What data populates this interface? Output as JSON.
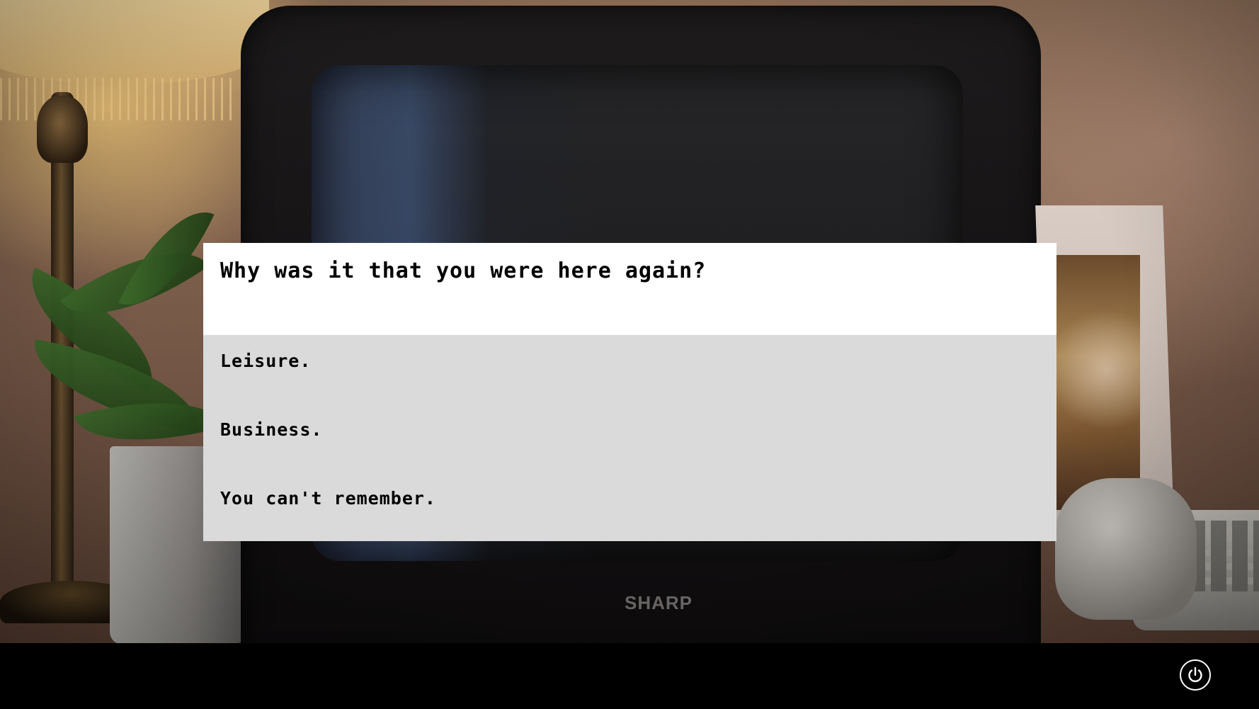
{
  "scene": {
    "tv_brand": "SHARP"
  },
  "dialog": {
    "prompt": "Why was it that you were here again?",
    "choices": [
      {
        "label": "Leisure."
      },
      {
        "label": "Business."
      },
      {
        "label": "You can't remember."
      }
    ]
  },
  "controls": {
    "power_icon": "power-icon"
  },
  "colors": {
    "prompt_background": "#ffffff",
    "choices_background": "#dadada",
    "text": "#000000",
    "bottom_bar": "#000000",
    "power_icon": "#ffffff"
  }
}
